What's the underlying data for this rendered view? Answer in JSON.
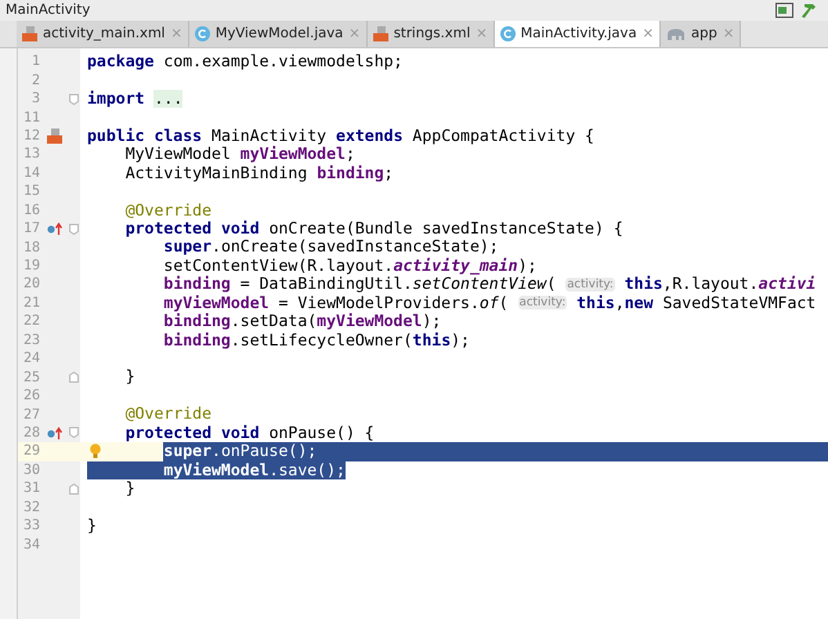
{
  "window": {
    "title": "MainActivity"
  },
  "tabs": [
    {
      "label": "activity_main.xml",
      "kind": "layout",
      "selected": false,
      "close": "×"
    },
    {
      "label": "MyViewModel.java",
      "kind": "class",
      "selected": false,
      "close": "×"
    },
    {
      "label": "strings.xml",
      "kind": "layout",
      "selected": false,
      "close": "×"
    },
    {
      "label": "MainActivity.java",
      "kind": "class",
      "selected": true,
      "close": "×"
    },
    {
      "label": "app",
      "kind": "module",
      "selected": false,
      "close": "×"
    }
  ],
  "editor": {
    "lines": [
      {
        "number": "1",
        "tokens": [
          {
            "t": "package",
            "kind": "kw"
          },
          {
            "t": " com.example.viewmodelshp;",
            "kind": "plain"
          }
        ]
      },
      {
        "number": "2"
      },
      {
        "number": "3",
        "fold": {
          "kind": "start"
        },
        "tokens": [
          {
            "t": "import ",
            "kind": "kw"
          },
          {
            "t": "...",
            "kind": "folded"
          }
        ]
      },
      {
        "number": "11"
      },
      {
        "number": "12",
        "gutter_icon": {
          "kind": "layout"
        },
        "tokens": [
          {
            "t": "public class",
            "kind": "kw"
          },
          {
            "t": " MainActivity ",
            "kind": "plain"
          },
          {
            "t": "extends",
            "kind": "kw"
          },
          {
            "t": " AppCompatActivity {",
            "kind": "plain"
          }
        ]
      },
      {
        "number": "13",
        "indent": {
          "kind": "single"
        },
        "tokens": [
          {
            "t": "MyViewModel ",
            "kind": "plain"
          },
          {
            "t": "myViewModel",
            "kind": "field"
          },
          {
            "t": ";",
            "kind": "plain"
          }
        ]
      },
      {
        "number": "14",
        "indent": {
          "kind": "single"
        },
        "tokens": [
          {
            "t": "ActivityMainBinding ",
            "kind": "plain"
          },
          {
            "t": "binding",
            "kind": "field"
          },
          {
            "t": ";",
            "kind": "plain"
          }
        ]
      },
      {
        "number": "15"
      },
      {
        "number": "16",
        "indent": {
          "kind": "single"
        },
        "tokens": [
          {
            "t": "@Override",
            "kind": "annotation"
          }
        ]
      },
      {
        "number": "17",
        "indent": {
          "kind": "single"
        },
        "gutter_icon": {
          "kind": "override"
        },
        "fold": {
          "kind": "start"
        },
        "tokens": [
          {
            "t": "protected void",
            "kind": "kw"
          },
          {
            "t": " onCreate(Bundle savedInstanceState) {",
            "kind": "plain"
          }
        ]
      },
      {
        "number": "18",
        "indent": {
          "kind": "double"
        },
        "tokens": [
          {
            "t": "super",
            "kind": "kw"
          },
          {
            "t": ".onCreate(savedInstanceState);",
            "kind": "plain"
          }
        ]
      },
      {
        "number": "19",
        "indent": {
          "kind": "double"
        },
        "tokens": [
          {
            "t": "setContentView(R.layout.",
            "kind": "plain"
          },
          {
            "t": "activity_main",
            "kind": "static"
          },
          {
            "t": ");",
            "kind": "plain"
          }
        ]
      },
      {
        "number": "20",
        "indent": {
          "kind": "double"
        },
        "tokens": [
          {
            "t": "binding",
            "kind": "field"
          },
          {
            "t": " = DataBindingUtil.",
            "kind": "plain"
          },
          {
            "t": "setContentView",
            "kind": "method"
          },
          {
            "t": "( ",
            "kind": "plain"
          },
          {
            "t": "activity:",
            "kind": "hint"
          },
          {
            "t": " this",
            "kind": "kw"
          },
          {
            "t": ",R.layout.",
            "kind": "plain"
          },
          {
            "t": "activi",
            "kind": "static"
          }
        ]
      },
      {
        "number": "21",
        "indent": {
          "kind": "double"
        },
        "tokens": [
          {
            "t": "myViewModel",
            "kind": "field"
          },
          {
            "t": " = ViewModelProviders.",
            "kind": "plain"
          },
          {
            "t": "of",
            "kind": "method"
          },
          {
            "t": "( ",
            "kind": "plain"
          },
          {
            "t": "activity:",
            "kind": "hint"
          },
          {
            "t": " this",
            "kind": "kw"
          },
          {
            "t": ",",
            "kind": "plain"
          },
          {
            "t": "new",
            "kind": "kw"
          },
          {
            "t": " SavedStateVMFact",
            "kind": "plain"
          }
        ]
      },
      {
        "number": "22",
        "indent": {
          "kind": "double"
        },
        "tokens": [
          {
            "t": "binding",
            "kind": "field"
          },
          {
            "t": ".setData(",
            "kind": "plain"
          },
          {
            "t": "myViewModel",
            "kind": "field"
          },
          {
            "t": ");",
            "kind": "plain"
          }
        ]
      },
      {
        "number": "23",
        "indent": {
          "kind": "double"
        },
        "tokens": [
          {
            "t": "binding",
            "kind": "field"
          },
          {
            "t": ".setLifecycleOwner(",
            "kind": "plain"
          },
          {
            "t": "this",
            "kind": "kw"
          },
          {
            "t": ");",
            "kind": "plain"
          }
        ]
      },
      {
        "number": "24"
      },
      {
        "number": "25",
        "indent": {
          "kind": "single"
        },
        "fold": {
          "kind": "end"
        },
        "tokens": [
          {
            "t": "}",
            "kind": "plain"
          }
        ]
      },
      {
        "number": "26"
      },
      {
        "number": "27",
        "indent": {
          "kind": "single"
        },
        "tokens": [
          {
            "t": "@Override",
            "kind": "annotation"
          }
        ]
      },
      {
        "number": "28",
        "indent": {
          "kind": "single"
        },
        "gutter_icon": {
          "kind": "override"
        },
        "fold": {
          "kind": "start"
        },
        "tokens": [
          {
            "t": "protected void",
            "kind": "kw"
          },
          {
            "t": " onPause() {",
            "kind": "plain"
          }
        ]
      },
      {
        "number": "29",
        "indent": {
          "kind": "double"
        },
        "current": true,
        "bulb": true,
        "indent_selected": false,
        "selected_tail": true,
        "tokens": [
          {
            "t": "super",
            "kind": "kw",
            "selected": true
          },
          {
            "t": ".onPause();",
            "kind": "plain",
            "selected": true
          }
        ]
      },
      {
        "number": "30",
        "indent": {
          "kind": "double"
        },
        "indent_selected": true,
        "tokens": [
          {
            "t": "myViewModel",
            "kind": "field",
            "selected": true
          },
          {
            "t": ".save();",
            "kind": "plain",
            "selected": true
          }
        ]
      },
      {
        "number": "31",
        "indent": {
          "kind": "single"
        },
        "fold": {
          "kind": "end"
        },
        "tokens": [
          {
            "t": "}",
            "kind": "plain"
          }
        ]
      },
      {
        "number": "32"
      },
      {
        "number": "33",
        "tokens": [
          {
            "t": "}",
            "kind": "plain"
          }
        ]
      },
      {
        "number": "34"
      }
    ]
  }
}
